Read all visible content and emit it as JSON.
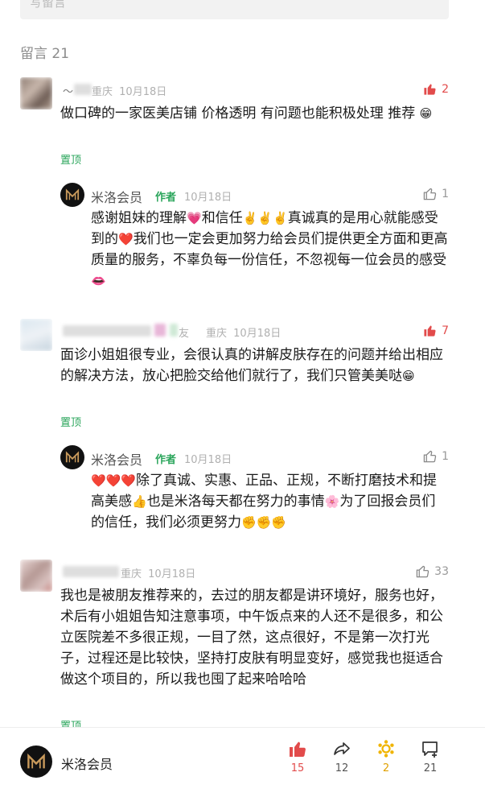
{
  "top_input": {
    "placeholder": "写留言"
  },
  "comment_count_label": "留言 21",
  "comments": [
    {
      "user": "～​",
      "location": "重庆",
      "date": "10月18日",
      "likes": "2",
      "liked": true,
      "text": "做口碑的一家医美店铺 价格透明  有问题也能积极处理  推荐",
      "emoji": "😁",
      "pinned": "置顶",
      "reply": {
        "name": "米洛会员",
        "tag": "作者",
        "date": "10月18日",
        "likes": "1",
        "text_html_parts": [
          "感谢姐妹的理解",
          "💗",
          "和信任",
          "✌️✌️✌️",
          "真诚真的是用心就能感受到的",
          "❤️",
          "我们也一定会更加努力给会员们提供更全方面和更高质量的服务，不辜负每一份信任，不忽视每一位会员的感受",
          "👄"
        ]
      }
    },
    {
      "user": "",
      "user_suffix": "友",
      "location": "重庆",
      "date": "10月18日",
      "likes": "7",
      "liked": true,
      "text": "面诊小姐姐很专业，会很认真的讲解皮肤存在的问题并给出相应的解决方法，放心把脸交给他们就行了，我们只管美美哒",
      "emoji": "😁",
      "pinned": "置顶",
      "reply": {
        "name": "米洛会员",
        "tag": "作者",
        "date": "10月18日",
        "likes": "1",
        "text_html_parts": [
          "❤️❤️❤️",
          "除了真诚、实惠、正品、正规，不断打磨技术和提高美感",
          "👍",
          "也是米洛每天都在努力的事情",
          "🌸",
          "为了回报会员们的信任，我们必须更努力",
          "✊✊✊"
        ]
      }
    },
    {
      "user": "",
      "location": "重庆",
      "date": "10月18日",
      "likes": "33",
      "liked": false,
      "text": "我也是被朋友推荐来的，去过的朋友都是讲环境好，服务也好，术后有小姐姐告知注意事项，中午饭点来的人还不是很多，和公立医院差不多很正规，一目了然，这点很好，不是第一次打光子，过程还是比较快，坚持打皮肤有明显变好，感觉我也挺适合做这个项目的，所以我也囤了起来哈哈哈",
      "pinned": "置顶"
    }
  ],
  "bottom_bar": {
    "account_name": "米洛会员",
    "like_count": "15",
    "share_count": "12",
    "wow_count": "2",
    "comment_count": "21"
  },
  "colors": {
    "accent_red": "#e24b4b",
    "pin_green": "#2aa55b",
    "gold": "#e0a000"
  }
}
